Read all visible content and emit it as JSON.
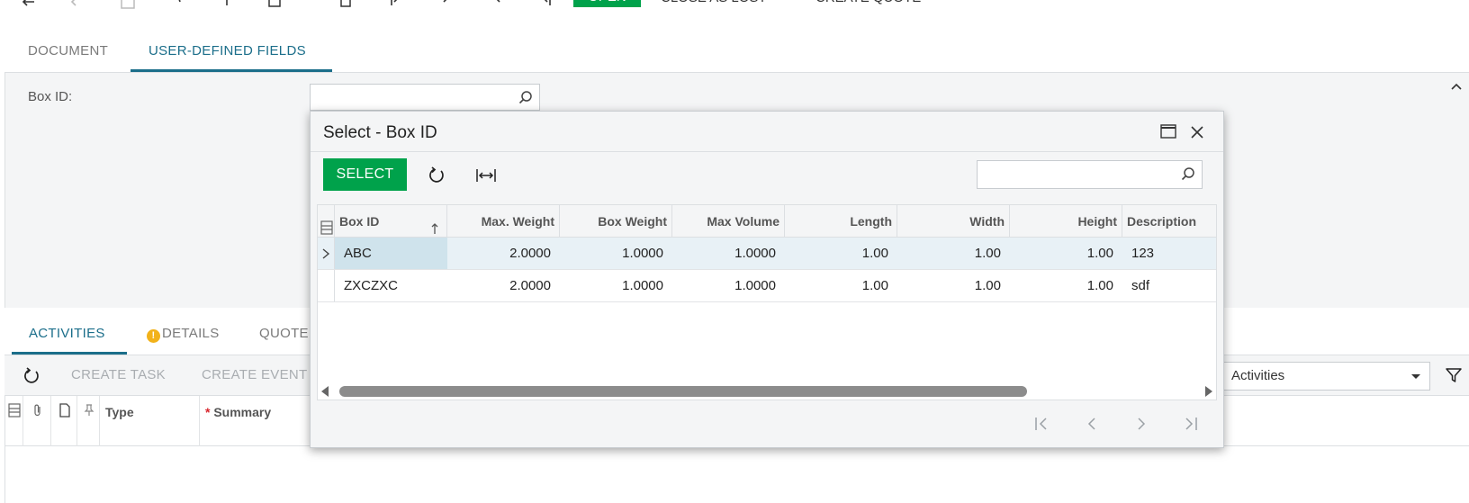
{
  "toolbar": {
    "open_label": "OPEN",
    "close_as_lost_label": "CLOSE AS LOST",
    "create_quote_label": "CREATE QUOTE"
  },
  "doc_tabs": {
    "document": "DOCUMENT",
    "user_defined_fields": "USER-DEFINED FIELDS"
  },
  "form": {
    "box_id_label": "Box ID:",
    "box_id_value": ""
  },
  "activity_tabs": {
    "activities": "ACTIVITIES",
    "details": "DETAILS",
    "quotes": "QUOTE"
  },
  "activity_toolbar": {
    "create_task": "CREATE TASK",
    "create_event": "CREATE EVENT",
    "filter_value": "Activities"
  },
  "activity_grid": {
    "type": "Type",
    "summary": "Summary",
    "required_mark": "*"
  },
  "modal": {
    "title": "Select - Box ID",
    "select_label": "SELECT",
    "search_value": "",
    "columns": {
      "box_id": "Box ID",
      "max_weight": "Max. Weight",
      "box_weight": "Box Weight",
      "max_volume": "Max Volume",
      "length": "Length",
      "width": "Width",
      "height": "Height",
      "description": "Description"
    },
    "rows": [
      {
        "box_id": "ABC",
        "max_weight": "2.0000",
        "box_weight": "1.0000",
        "max_volume": "1.0000",
        "length": "1.00",
        "width": "1.00",
        "height": "1.00",
        "description": "123"
      },
      {
        "box_id": "ZXCZXC",
        "max_weight": "2.0000",
        "box_weight": "1.0000",
        "max_volume": "1.0000",
        "length": "1.00",
        "width": "1.00",
        "height": "1.00",
        "description": "sdf"
      }
    ]
  },
  "colors": {
    "accent_green": "#00a24b",
    "tab_active": "#1b6e8a",
    "selected_row": "#e8f1f6",
    "warning": "#f2b21a"
  }
}
